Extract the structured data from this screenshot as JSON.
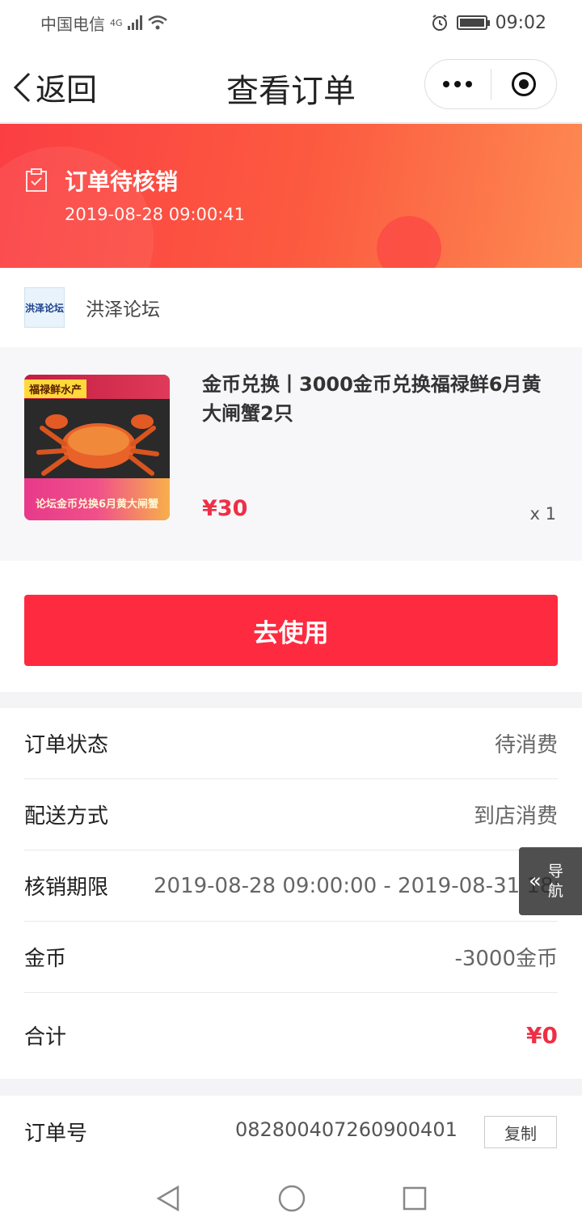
{
  "status_bar": {
    "carrier": "中国电信",
    "network": "4G",
    "time": "09:02"
  },
  "nav": {
    "back_label": "返回",
    "title": "查看订单"
  },
  "order_status": {
    "title": "订单待核销",
    "time": "2019-08-28 09:00:41"
  },
  "shop": {
    "logo_text": "洪泽论坛",
    "name": "洪泽论坛"
  },
  "product": {
    "thumb_tag": "福禄鲜水产",
    "thumb_caption": "论坛金币兑换6月黄大闸蟹",
    "title": "金币兑换丨3000金币兑换福禄鲜6月黄大闸蟹2只",
    "price": "¥30",
    "quantity": "x 1"
  },
  "action": {
    "use_label": "去使用"
  },
  "info": {
    "status_label": "订单状态",
    "status_value": "待消费",
    "delivery_label": "配送方式",
    "delivery_value": "到店消费",
    "validity_label": "核销期限",
    "validity_value": "2019-08-28 09:00:00 - 2019-08-31 18:22:32",
    "coins_label": "金币",
    "coins_value": "-3000金币",
    "total_label": "合计",
    "total_value": "¥0"
  },
  "float_nav": {
    "label": "导航"
  },
  "order_number": {
    "label": "订单号",
    "value": "082800407260900401",
    "copy_label": "复制"
  },
  "colors": {
    "accent_red": "#fe2a3f",
    "price_red": "#ee2f45",
    "banner_start": "#fb3e43",
    "banner_end": "#fd8a52"
  },
  "icons": [
    "chevron-left-icon",
    "more-dots-icon",
    "target-icon",
    "order-check-icon",
    "double-chevron-left-icon",
    "back-triangle-icon",
    "home-circle-icon",
    "recent-square-icon"
  ]
}
